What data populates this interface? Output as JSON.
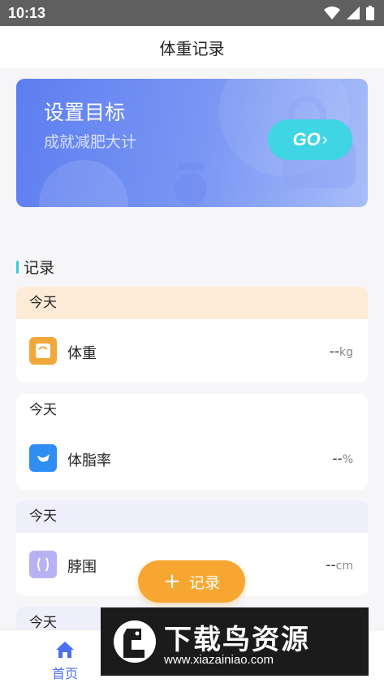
{
  "status": {
    "time": "10:13"
  },
  "header": {
    "title": "体重记录"
  },
  "banner": {
    "title": "设置目标",
    "subtitle": "成就减肥大计",
    "go": "GO"
  },
  "section": {
    "title": "记录"
  },
  "records": [
    {
      "date": "今天",
      "name": "体重",
      "value": "--",
      "unit": "kg",
      "header_color": "#fdebd6",
      "icon_color": "#f2a73a"
    },
    {
      "date": "今天",
      "name": "体脂率",
      "value": "--",
      "unit": "%",
      "header_color": "#ffffff",
      "icon_color": "#2f8ef3"
    },
    {
      "date": "今天",
      "name": "脖围",
      "value": "--",
      "unit": "cm",
      "header_color": "#efeefb",
      "icon_color": "#b6b2f3"
    },
    {
      "date": "今天"
    }
  ],
  "fab": {
    "label": "记录"
  },
  "tabbar": {
    "home": "首页"
  },
  "watermark": {
    "title": "下载鸟资源",
    "url": "www.xiazainiao.com"
  }
}
